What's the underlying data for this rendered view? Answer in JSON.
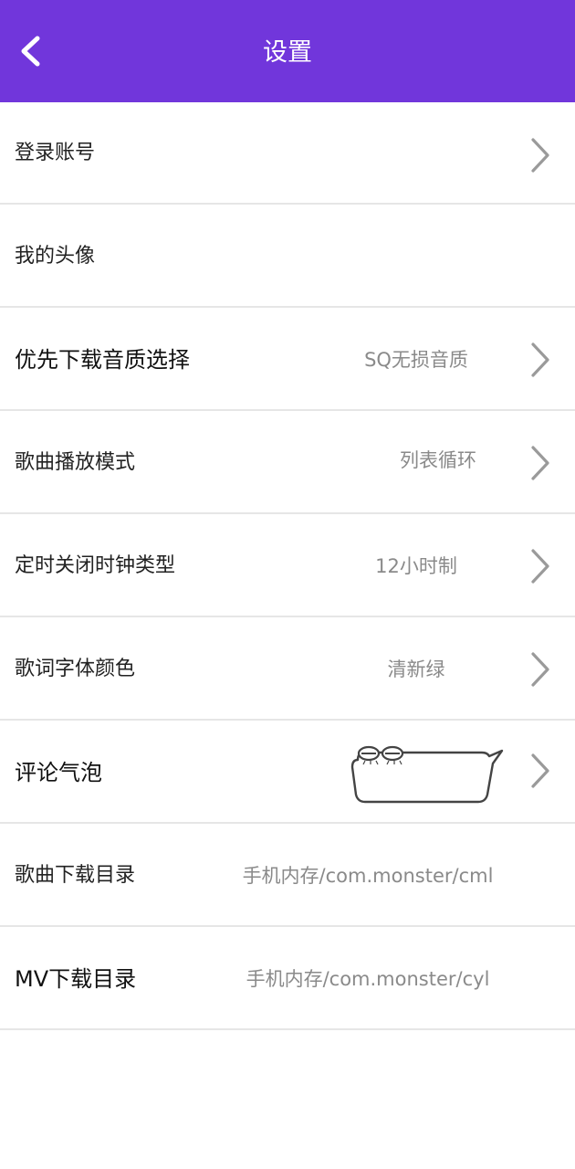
{
  "header": {
    "title": "设置",
    "back_icon": "chevron-left-icon",
    "background_color": "#7136db"
  },
  "settings": {
    "login": {
      "label": "登录账号"
    },
    "avatar": {
      "label": "我的头像"
    },
    "download_quality": {
      "label": "优先下载音质选择",
      "value": "SQ无损音质"
    },
    "play_mode": {
      "label": "歌曲播放模式",
      "value": "列表循环"
    },
    "timer_clock": {
      "label": "定时关闭时钟类型",
      "value": "12小时制"
    },
    "lyric_color": {
      "label": "歌词字体颜色",
      "value": "清新绿"
    },
    "comment_bubble": {
      "label": "评论气泡",
      "preview_icon": "speech-bubble-icon"
    },
    "song_dir": {
      "label": "歌曲下载目录",
      "value": "手机内存/com.monster/cml"
    },
    "mv_dir": {
      "label": "MV下载目录",
      "value": "手机内存/com.monster/cyl"
    }
  },
  "icons": {
    "row_arrow": "chevron-right-icon"
  }
}
